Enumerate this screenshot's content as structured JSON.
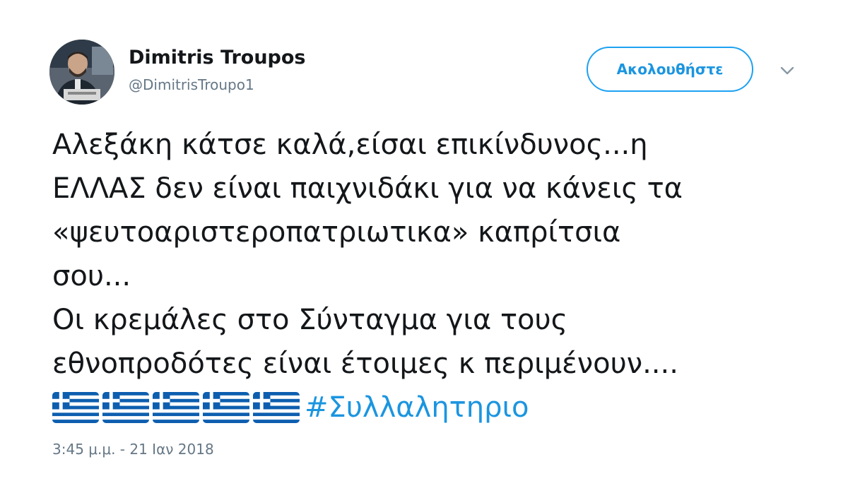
{
  "user": {
    "display_name": "Dimitris Troupos",
    "handle": "@DimitrisTroupo1"
  },
  "actions": {
    "follow_label": "Ακολουθήστε",
    "menu_icon": "chevron-down-icon"
  },
  "tweet": {
    "lines": [
      "Αλεξάκη κάτσε καλά,είσαι επικίνδυνος...η",
      "ΕΛΛΑΣ δεν είναι παιχνιδάκι για να κάνεις τα",
      "«ψευτοαριστεροπατριωτικα» καπρίτσια",
      "σου...",
      "Οι κρεμάλες στο Σύνταγμα για τους",
      "εθνοπροδότες είναι έτοιμες κ περιμένουν...."
    ],
    "flag_emoji": "greece-flag-emoji",
    "flag_count": 5,
    "hashtag": "#Συλλαλητηριο",
    "timestamp": "3:45 μ.μ. - 21 Ιαν 2018"
  },
  "colors": {
    "accent": "#1da1f2",
    "link": "#1b95e0",
    "secondary_text": "#657786",
    "flag_blue": "#0d5eaf"
  }
}
